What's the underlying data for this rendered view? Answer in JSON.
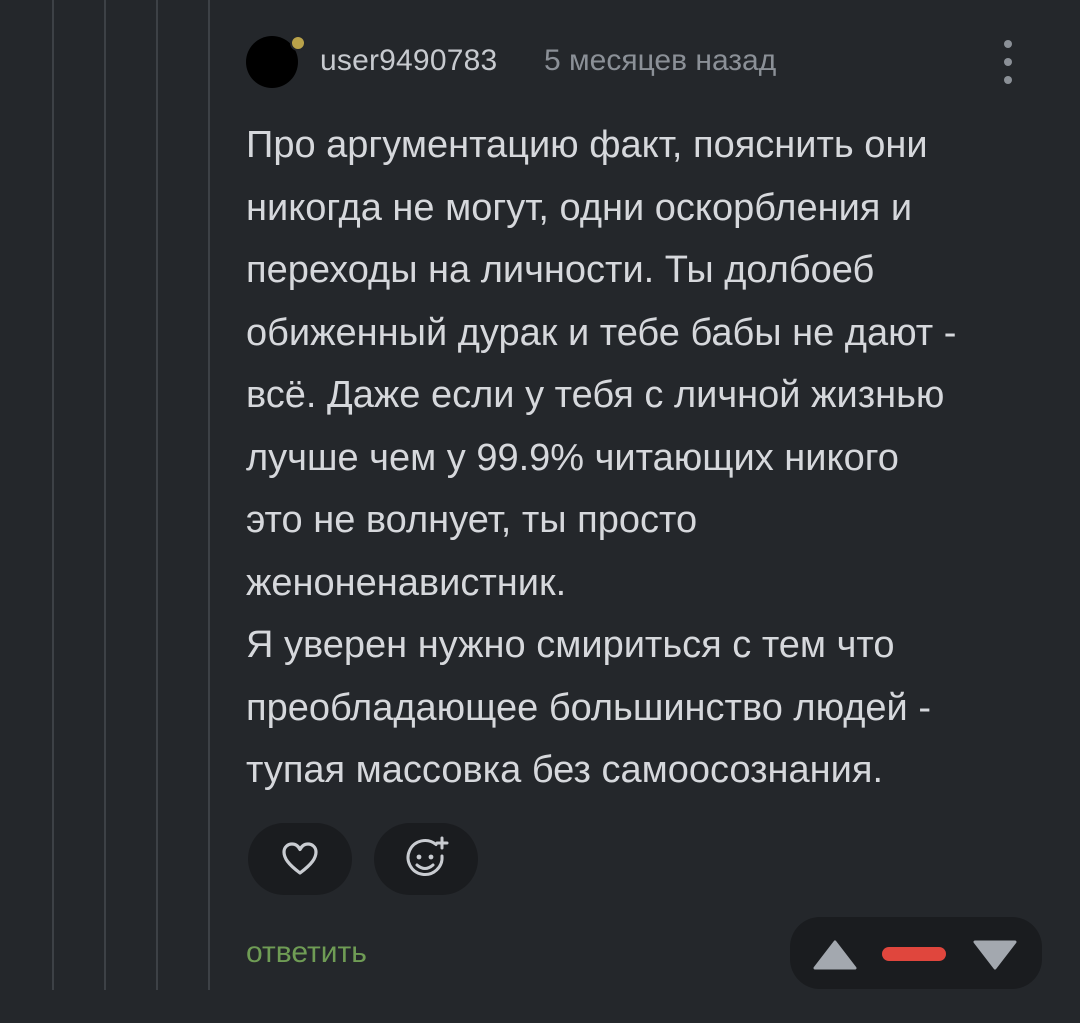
{
  "comment": {
    "username": "user9490783",
    "timestamp": "5 месяцев назад",
    "text": "Про аргументацию факт, пояснить они\nникогда не могут, одни оскорбления и\nпереходы на личности. Ты долбоеб\nобиженный дурак и тебе бабы не дают -\nвсё. Даже если у тебя с личной жизнью\nлучше чем у 99.9% читающих никого\nэто не волнует, ты просто\nженоненавистник.\nЯ уверен нужно смириться с тем что\nпреобладающее большинство людей -\nтупая массовка без самоосознания.",
    "reply_label": "ответить",
    "icons": {
      "like": "heart-icon",
      "emoji": "add-emoji-icon",
      "menu": "more-vertical-icon",
      "upvote": "triangle-up-icon",
      "downvote": "triangle-down-icon"
    },
    "colors": {
      "background": "#24272b",
      "reply_link": "#6f9c55",
      "rating_bar": "#e0463d",
      "avatar_badge": "#b9a24a"
    }
  }
}
